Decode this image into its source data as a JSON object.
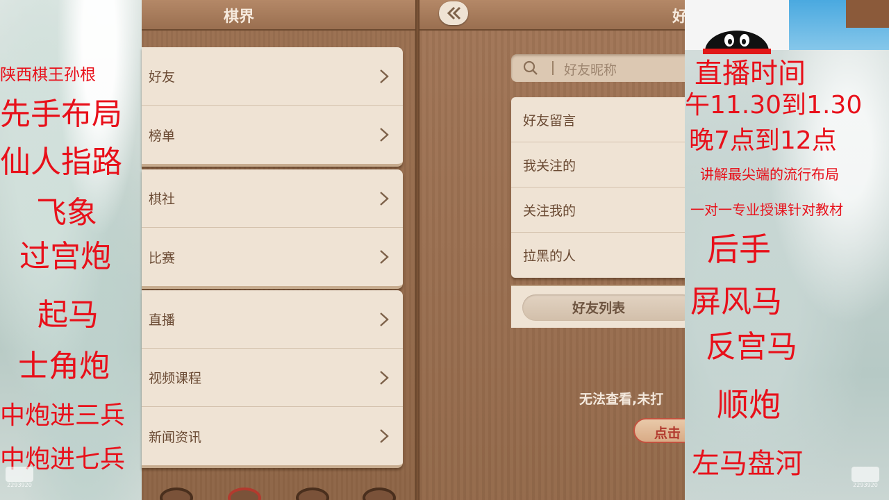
{
  "left_screen": {
    "title": "棋界",
    "menu_groups": [
      [
        {
          "label": "好友"
        },
        {
          "label": "榜单"
        }
      ],
      [
        {
          "label": "棋社"
        },
        {
          "label": "比赛"
        }
      ],
      [
        {
          "label": "直播"
        },
        {
          "label": "视频课程"
        },
        {
          "label": "新闻资讯"
        }
      ]
    ]
  },
  "right_screen": {
    "title_partial": "好",
    "search": {
      "placeholder": "好友昵称"
    },
    "friend_menu": [
      "好友留言",
      "我关注的",
      "关注我的",
      "拉黑的人"
    ],
    "friend_list_button": "好友列表",
    "empty_message": "无法查看,未打",
    "action_button": "点击"
  },
  "left_overlay": {
    "items": [
      "陕西棋王孙根",
      "先手布局",
      "仙人指路",
      "飞象",
      "过宫炮",
      "起马",
      "士角炮",
      "中炮进三兵",
      "中炮进七兵"
    ]
  },
  "right_overlay": {
    "items": [
      "直播时间",
      "午11.30到1.30",
      "晚7点到12点",
      "讲解最尖端的流行布局",
      "一对一专业授课针对教材",
      "后手",
      "屏风马",
      "反宫马",
      "顺炮",
      "左马盘河"
    ]
  },
  "watermark": {
    "text": "2293920"
  },
  "colors": {
    "overlay_text": "#e8101a",
    "wood": "#9b7051",
    "card": "#efe3d4",
    "menu_text": "#6a4a33"
  },
  "icons": [
    "chevron-right-icon",
    "search-icon",
    "back-arrow-icon",
    "qq-penguin-icon"
  ]
}
